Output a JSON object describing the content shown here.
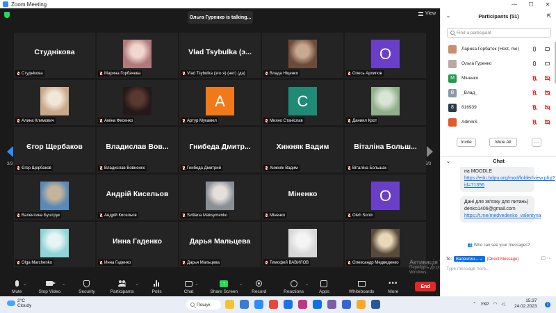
{
  "window": {
    "title": "Zoom Meeting",
    "controls": [
      "—",
      "☐",
      "✕"
    ]
  },
  "meeting": {
    "talking": "Ольга Гуренко is talking...",
    "view_label": "View",
    "page_indicator": "3/3"
  },
  "tiles": [
    {
      "kind": "name",
      "big": "Студнікова",
      "label": "Студнікова"
    },
    {
      "kind": "photo",
      "label": "Марина Горбачева",
      "colors": [
        "#b07a7a",
        "#f0d6d0"
      ]
    },
    {
      "kind": "name",
      "big": "Vlad Tsybulka (э...",
      "label": "Vlad Tsybulka (это я) (нет) (да)"
    },
    {
      "kind": "photo",
      "label": "Влада Ніценко",
      "colors": [
        "#6d4b3a",
        "#c8a890"
      ]
    },
    {
      "kind": "avatar",
      "letter": "O",
      "color": "#6a3fc8",
      "label": "Олесь Архипов"
    },
    {
      "kind": "photo",
      "label": "Алина Климович",
      "colors": [
        "#c9a98a",
        "#f2e6d8"
      ]
    },
    {
      "kind": "photo",
      "label": "Аміна Фесенко",
      "colors": [
        "#241818",
        "#5a3a30"
      ]
    },
    {
      "kind": "avatar",
      "letter": "А",
      "color": "#f07a1a",
      "label": "Артур Мукамел"
    },
    {
      "kind": "avatar",
      "letter": "С",
      "color": "#1f8a76",
      "label": "Михно Станіслав"
    },
    {
      "kind": "photo",
      "label": "Даниил Крот",
      "colors": [
        "#8fb08a",
        "#d8e4d4"
      ]
    },
    {
      "kind": "name",
      "big": "Єгор Щербаков",
      "label": "Єгор Щербаков"
    },
    {
      "kind": "name",
      "big": "Владислав Вов...",
      "label": "Владислав Вовненко"
    },
    {
      "kind": "name",
      "big": "Гнибеда Дмитр...",
      "label": "Гнибеда Дмитрий"
    },
    {
      "kind": "name",
      "big": "Хижняк Вадим",
      "label": "Хижняк Вадим"
    },
    {
      "kind": "name",
      "big": "Віталіна Больш...",
      "label": "Віталіна Большак"
    },
    {
      "kind": "photo",
      "label": "Валентина Буштрук",
      "colors": [
        "#5b8ab8",
        "#c6b49a"
      ]
    },
    {
      "kind": "name",
      "big": "Андрій Кисельов",
      "label": "Андрій Кисельов"
    },
    {
      "kind": "photo",
      "label": "Svitlana Maksymenko",
      "colors": [
        "#8a8f96",
        "#e6e0da"
      ]
    },
    {
      "kind": "name",
      "big": "Міненко",
      "label": "Міненко"
    },
    {
      "kind": "avatar",
      "letter": "O",
      "color": "#6a3fc8",
      "label": "Oleh Sonin"
    },
    {
      "kind": "photo",
      "label": "Olga Marchenko",
      "colors": [
        "#8fd4d8",
        "#e8f4f4"
      ]
    },
    {
      "kind": "name",
      "big": "Инна Гаденко",
      "label": "Инна Гаденко"
    },
    {
      "kind": "name",
      "big": "Дарья Мальцева",
      "label": "Дарья Мальцева"
    },
    {
      "kind": "photo",
      "label": "Тимофей ВАВИЛОВ",
      "colors": [
        "#d8d8d8",
        "#f4f4f4"
      ]
    },
    {
      "kind": "photo",
      "label": "Олександр Медведенко",
      "colors": [
        "#5a4a3a",
        "#e8d8b8"
      ]
    }
  ],
  "toolbar": {
    "mute": "Mute",
    "stop_video": "Stop Video",
    "security": "Security",
    "participants": "Participants",
    "participants_count": "51",
    "polls": "Polls",
    "chat": "Chat",
    "share": "Share Screen",
    "record": "Record",
    "reactions": "Reactions",
    "apps": "Apps",
    "whiteboards": "Whiteboards",
    "more": "More",
    "end": "End"
  },
  "participants_panel": {
    "title": "Participants (51)",
    "search_placeholder": "Find a participant",
    "rows": [
      {
        "name": "Лариса Горбаток (Host, me)",
        "avatar_kind": "photo",
        "color": "#c89070",
        "letter": "",
        "mic_muted": false,
        "cam_off": false
      },
      {
        "name": "Ольга Гуренко",
        "avatar_kind": "photo",
        "color": "#bba8a0",
        "letter": "",
        "mic_muted": false,
        "cam_off": false
      },
      {
        "name": "Міненко",
        "avatar_kind": "letter",
        "color": "#1f9a4a",
        "letter": "M",
        "mic_muted": true,
        "cam_off": true
      },
      {
        "name": "_Влад_",
        "avatar_kind": "letter",
        "color": "#8a98a8",
        "letter": "B",
        "mic_muted": true,
        "cam_off": true
      },
      {
        "name": "816939",
        "avatar_kind": "letter",
        "color": "#2a3a4a",
        "letter": "8",
        "mic_muted": true,
        "cam_off": true
      },
      {
        "name": "AdminS",
        "avatar_kind": "letter",
        "color": "#e05a2a",
        "letter": "",
        "mic_muted": true,
        "cam_off": true
      }
    ],
    "invite": "Invite",
    "mute_all": "Mute All",
    "more": "···"
  },
  "chat_panel": {
    "title": "Chat",
    "msg1_text": "на MOODLE",
    "msg1_link": "https://edu.bdpu.org/mod/folder/view.php?id=71356",
    "msg2_text": "Дані для зв'язку для питань)",
    "msg2_email": "denko1406@gmail.com",
    "msg2_link": "https://t.me/medvedenko_valentyna",
    "see_msgs": "Who can see your messages?",
    "to_label": "To:",
    "to_value": "Валентин...",
    "direct": "(Direct Message)",
    "input_placeholder": "Type message here..."
  },
  "activate_windows": {
    "title": "Активація Windows",
    "line2": "Перейдіть до розділу \"Настройки\", щоб активувати",
    "line3": "Windows."
  },
  "taskbar": {
    "temp": "2°C",
    "condition": "Cloudy",
    "search": "Пошук",
    "lang": "УКР",
    "time": "15:37",
    "date": "24.02.2023",
    "notif_count": "2",
    "app_colors": [
      "#f4c430",
      "#3a7bd5",
      "#2d8cff",
      "#e8473c",
      "#1a73e8",
      "#c13584",
      "#0e71eb",
      "#7b5ea7",
      "#3367d6",
      "#f9a825",
      "#2b579a"
    ]
  }
}
